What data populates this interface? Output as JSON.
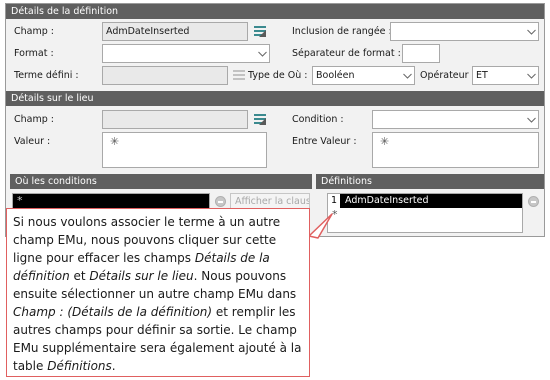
{
  "details_definition": {
    "header": "Détails de la définition",
    "champ_label": "Champ :",
    "champ_value": "AdmDateInserted",
    "inclusion_label": "Inclusion de rangée :",
    "inclusion_value": "",
    "format_label": "Format :",
    "format_value": "",
    "separator_label": "Séparateur de format :",
    "separator_value": "",
    "terme_label": "Terme défini :",
    "terme_value": "",
    "type_label": "Type de Où :",
    "type_value": "Booléen",
    "operator_label": "Opérateur :",
    "operator_value": "ET"
  },
  "details_lieu": {
    "header": "Détails sur le lieu",
    "champ_label": "Champ :",
    "champ_value": "",
    "condition_label": "Condition :",
    "condition_value": "",
    "valeur_label": "Valeur :",
    "valeur_value": "",
    "entre_valeur_label": "Entre Valeur :",
    "entre_valeur_value": ""
  },
  "ou_conditions": {
    "header": "Où les conditions",
    "row_marker": "*",
    "afficher_button": "Afficher la clause"
  },
  "definitions": {
    "header": "Définitions",
    "rows": [
      {
        "index": "1",
        "value": "AdmDateInserted"
      }
    ],
    "new_row_marker": "*"
  },
  "callout": {
    "part1": "Si nous voulons associer le terme à un autre champ EMu, nous pouvons cliquer sur cette ligne pour effacer les champs ",
    "italic1": "Détails de la définition",
    "part2": " et ",
    "italic2": "Détails sur le lieu",
    "part3": ". Nous pouvons ensuite sélectionner un autre champ EMu dans ",
    "italic3": "Champ : (Détails de la définition)",
    "part4": " et remplir les autres champs pour définir sa sortie. Le champ EMu supplémentaire sera également ajouté à la table ",
    "italic4": "Définitions",
    "part5": "."
  },
  "colors": {
    "section_header_bg": "#5f5f5f",
    "selected_row_bg": "#000000",
    "callout_border": "#e06060",
    "picker_icon": "#3b8a8f"
  }
}
